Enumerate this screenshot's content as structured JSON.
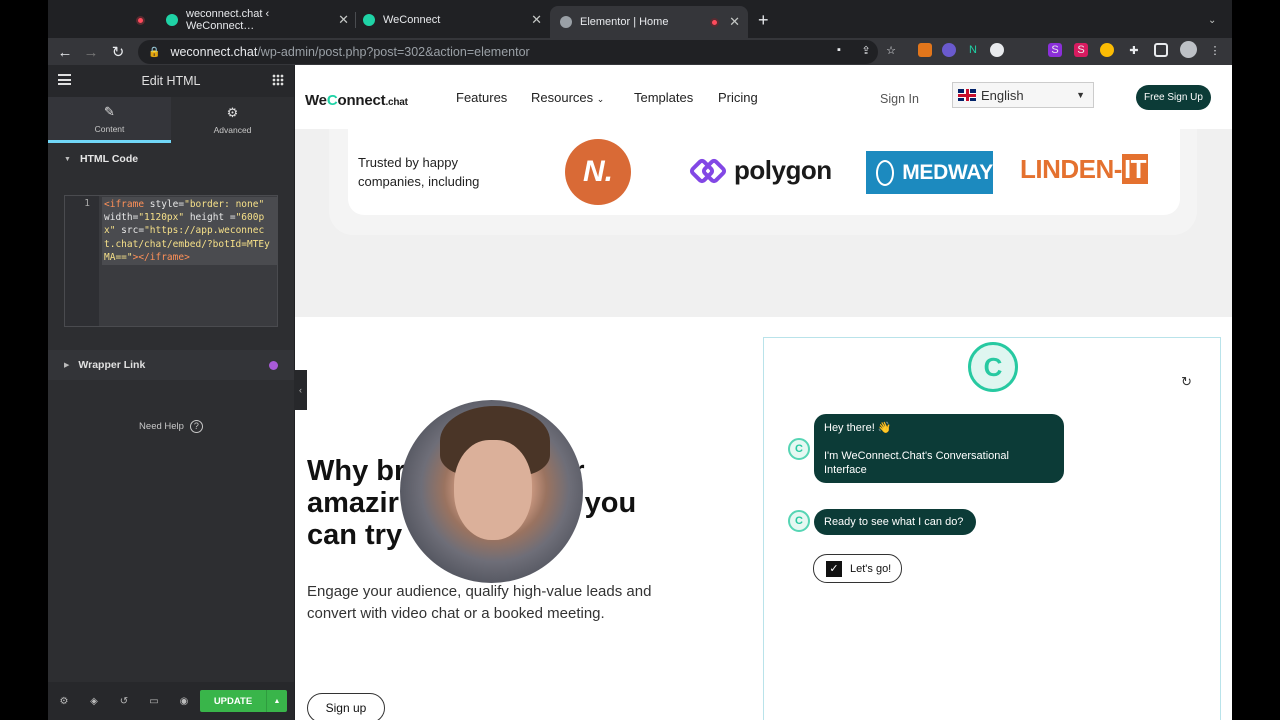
{
  "browser": {
    "tabs": [
      {
        "title": "weconnect.chat ‹ WeConnect…"
      },
      {
        "title": "WeConnect"
      },
      {
        "title": "Elementor | Home"
      }
    ],
    "new_tab": "+",
    "tab_close": "✕",
    "url": {
      "host": "weconnect.chat",
      "path": "/wp-admin/post.php?post=302&action=elementor"
    }
  },
  "panel": {
    "title": "Edit HTML",
    "tabs": [
      {
        "label": "Content"
      },
      {
        "label": "Advanced"
      }
    ],
    "section_html": "HTML Code",
    "code": {
      "line_number": "1",
      "tag_open": "<iframe",
      "attr_style": " style=",
      "val_style": "\"border: none\"",
      "attr_width": " width=",
      "val_width": "\"1120px\"",
      "attr_height": " height =",
      "val_height": "\"600px\"",
      "attr_src": " src=",
      "val_src": "\"https://app.weconnect.chat/chat/embed/?botId=MTEyMA==\"",
      "tag_close": "></iframe>"
    },
    "section_wrapper": "Wrapper Link",
    "need_help": "Need Help",
    "update": "UPDATE"
  },
  "site": {
    "logo": {
      "pre": "We",
      "c": "C",
      "post": "onnect",
      "tld": ".chat"
    },
    "menu": [
      "Features",
      "Resources",
      "Templates",
      "Pricing"
    ],
    "signin": "Sign In",
    "language": "English",
    "cta": "Free Sign Up",
    "trusted": "Trusted by happy companies, including",
    "logos": {
      "n": "N.",
      "polygon": "polygon",
      "medway": "MEDWAY",
      "linden": "LINDEN-",
      "linden_it": "IT"
    },
    "hero_title": "Why bother with your amazing website if you can try",
    "hero_title_visible_1": "Why br",
    "hero_title_visible_1b": "r",
    "hero_title_visible_2": "amazir",
    "hero_title_visible_2b": "f you",
    "hero_title_visible_3": "can try",
    "hero_sub": "Engage your audience, qualify high-value leads and convert with video chat or a booked meeting.",
    "hero_btn": "Sign up"
  },
  "chat": {
    "greeting": "Hey there! 👋",
    "intro": "I'm WeConnect.Chat's Conversational Interface",
    "question": "Ready to see what I can do?",
    "choice": "Let's go!"
  }
}
